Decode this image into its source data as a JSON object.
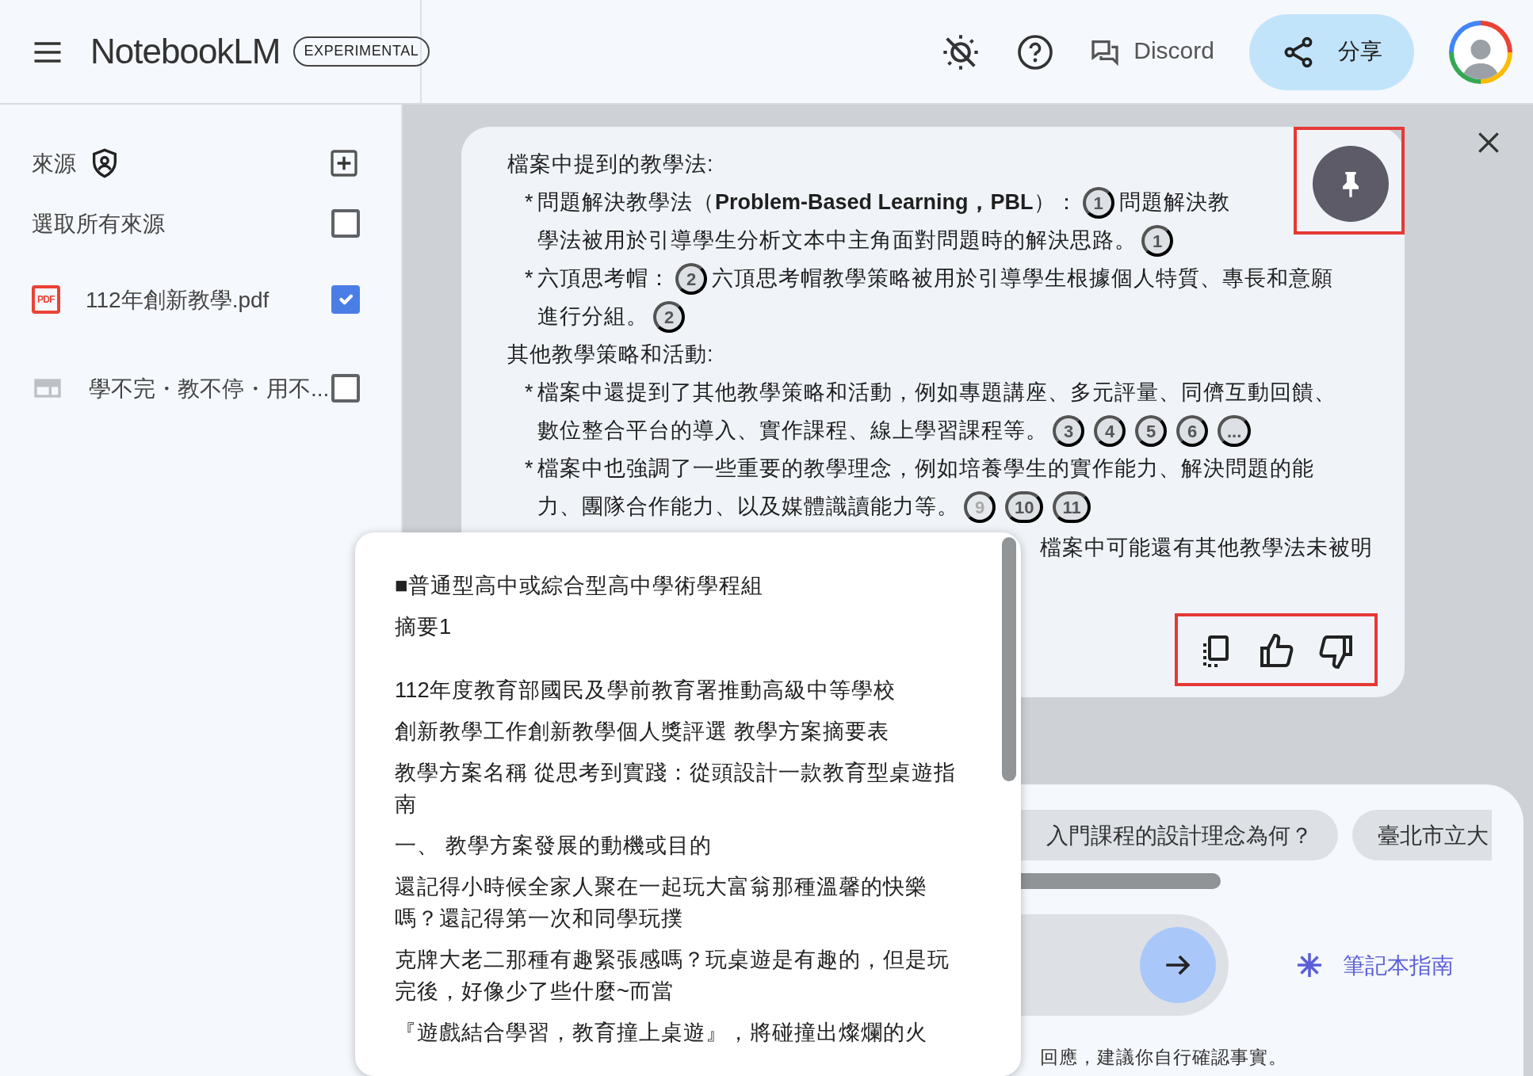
{
  "header": {
    "title": "NotebookLM",
    "badge": "EXPERIMENTAL",
    "discord": "Discord",
    "share": "分享"
  },
  "sidebar": {
    "heading": "來源",
    "select_all": {
      "label": "選取所有來源",
      "checked": false
    },
    "sources": [
      {
        "kind": "pdf",
        "icon_label": "PDF",
        "label": "112年創新教學.pdf",
        "checked": true
      },
      {
        "kind": "web",
        "label": "學不完・教不停・用不...",
        "checked": false
      }
    ]
  },
  "response": {
    "sections": [
      {
        "heading": "檔案中提到的教學法:",
        "items": [
          {
            "bullet": "*",
            "parts": [
              {
                "kind": "text",
                "text": "問題解決教學法（**Problem-Based Learning，PBL**）："
              },
              {
                "kind": "cite",
                "text": "1",
                "dim": false
              },
              {
                "kind": "text",
                "text": "問題解決教"
              },
              {
                "kind": "text",
                "text": "學法被用於引導學生分析文本中主角面對問題時的解決思路。"
              },
              {
                "kind": "cite",
                "text": "1",
                "dim": false
              }
            ]
          },
          {
            "bullet": "*",
            "parts": [
              {
                "kind": "text",
                "text": "六頂思考帽："
              },
              {
                "kind": "cite",
                "text": "2",
                "dim": false
              },
              {
                "kind": "text",
                "text": "六頂思考帽教學策略被用於引導學生根據個人特質、專長和意願"
              },
              {
                "kind": "text",
                "text": "進行分組。"
              },
              {
                "kind": "cite",
                "text": "2",
                "dim": false
              }
            ]
          }
        ]
      },
      {
        "heading": "其他教學策略和活動:",
        "items": [
          {
            "bullet": "*",
            "parts": [
              {
                "kind": "text",
                "text": "檔案中還提到了其他教學策略和活動，例如專題講座、多元評量、同儕互動回饋、"
              },
              {
                "kind": "text",
                "text": "數位整合平台的導入、實作課程、線上學習課程等。"
              },
              {
                "kind": "cite",
                "text": "3",
                "dim": false
              },
              {
                "kind": "cite",
                "text": "4",
                "dim": false
              },
              {
                "kind": "cite",
                "text": "5",
                "dim": false
              },
              {
                "kind": "cite",
                "text": "6",
                "dim": false
              },
              {
                "kind": "cite",
                "text": "...",
                "dim": false
              }
            ]
          },
          {
            "bullet": "*",
            "parts": [
              {
                "kind": "text",
                "text": "檔案中也強調了一些重要的教學理念，例如培養學生的實作能力、解決問題的能"
              },
              {
                "kind": "text",
                "text": "力、團隊合作能力、以及媒體識讀能力等。"
              },
              {
                "kind": "cite",
                "text": "9",
                "dim": true
              },
              {
                "kind": "cite",
                "text": "10",
                "dim": false
              },
              {
                "kind": "cite",
                "text": "11",
                "dim": false
              }
            ]
          }
        ]
      }
    ],
    "trailing_text": "檔案中可能還有其他教學法未被明"
  },
  "source_preview": {
    "blocks": [
      [
        "■普通型高中或綜合型高中學術學程組",
        "摘要1"
      ],
      [
        "112年度教育部國民及學前教育署推動高級中等學校",
        "創新教學工作創新教學個人獎評選 教學方案摘要表",
        "教學方案名稱 從思考到實踐：從頭設計一款教育型桌遊指南",
        "一、 教學方案發展的動機或目的",
        "還記得小時候全家人聚在一起玩大富翁那種溫馨的快樂嗎？還記得第一次和同學玩撲",
        "克牌大老二那種有趣緊張感嗎？玩桌遊是有趣的，但是玩完後，好像少了些什麼~而當",
        "『遊戲結合學習，教育撞上桌遊』，將碰撞出燦爛的火"
      ]
    ]
  },
  "chat": {
    "suggestions": [
      "入門課程的設計理念為何？",
      "臺北市立大"
    ],
    "guide": "筆記本指南",
    "footer": "回應，建議你自行確認事實。"
  }
}
